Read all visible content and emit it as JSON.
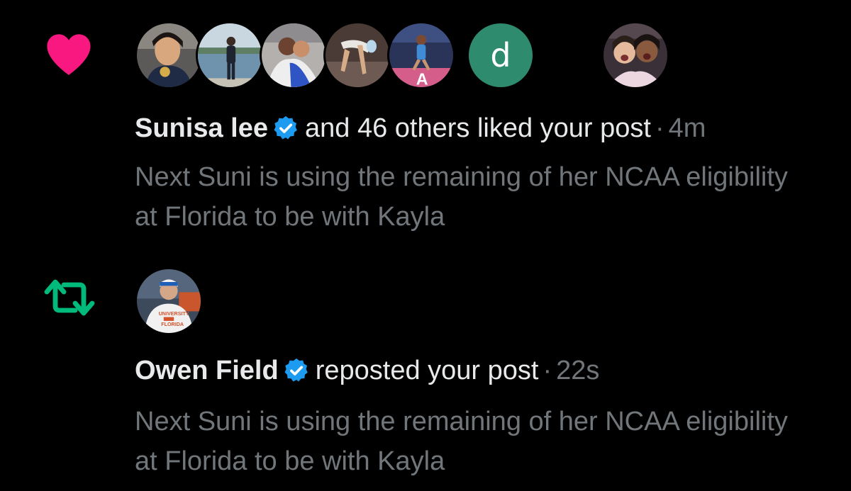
{
  "colors": {
    "background": "#000000",
    "like": "#f91880",
    "repost": "#00ba7c",
    "verified": "#1d9bf0",
    "text_primary": "#e7e9ea",
    "text_secondary": "#71767b",
    "letter_avatar": "#2e8b6e"
  },
  "notifications": [
    {
      "type": "like",
      "icon": "heart-icon",
      "avatars": [
        "gymnast-medal-photo",
        "woman-on-dock-photo",
        "hugging-gymnasts-photo",
        "gymnast-flip-photo",
        "gymnast-arena-photo",
        "letter-avatar",
        "two-women-selfie-photo"
      ],
      "avatar_letter": "d",
      "actor": "Sunisa lee",
      "verified_icon": "verified-badge-icon",
      "action": "and 46 others liked your post",
      "separator": "·",
      "time": "4m",
      "snippet": "Next Suni is using the remaining of her NCAA eligibility at Florida to be with Kayla"
    },
    {
      "type": "repost",
      "icon": "repost-icon",
      "avatars": [
        "man-florida-shirt-photo"
      ],
      "actor": "Owen Field",
      "verified_icon": "verified-badge-icon",
      "action": "reposted your post",
      "separator": "·",
      "time": "22s",
      "snippet": "Next Suni is using the remaining of her NCAA eligibility at Florida to be with Kayla"
    }
  ]
}
